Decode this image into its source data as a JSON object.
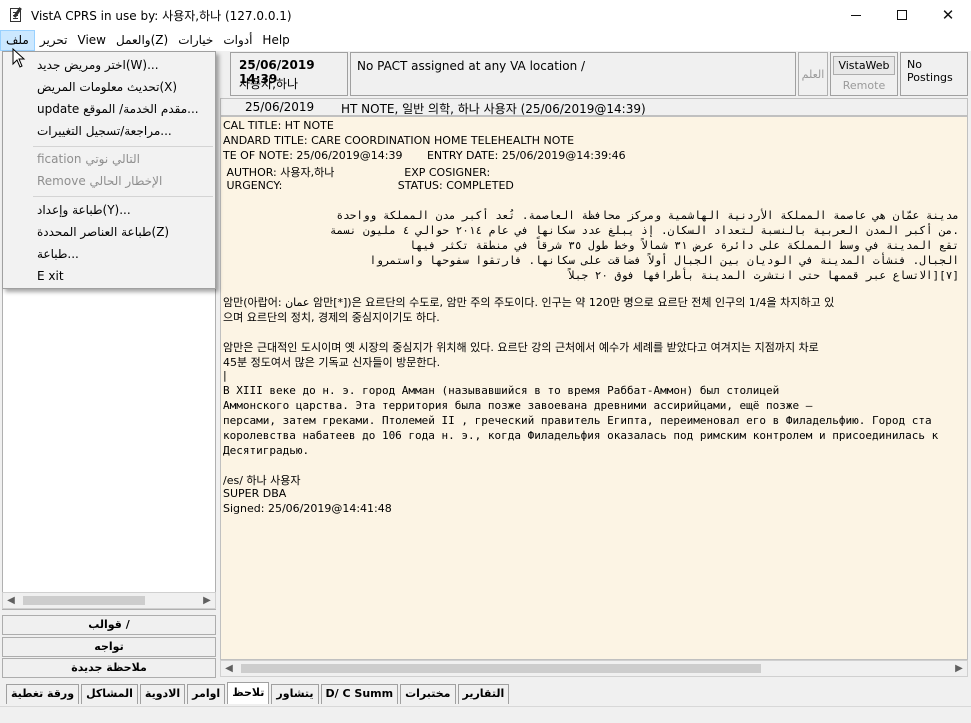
{
  "window": {
    "title": "VistA CPRS in use by: 사용자,하나  (127.0.0.1)",
    "minimize": "—",
    "maximize": "☐",
    "close": "✕"
  },
  "menubar": {
    "items": [
      "ملف",
      "تحرير",
      "View",
      "والعمل(Z)",
      "خيارات",
      "أدوات",
      "Help"
    ]
  },
  "header": {
    "date": "25/06/2019 14:39",
    "patient": "사용자,하나",
    "pact": "No PACT assigned at any VA location /",
    "flag": "العلم",
    "vistaweb": "VistaWeb",
    "remote_data": "Remote Data",
    "postings": "No Postings"
  },
  "file_menu": {
    "items": [
      {
        "label": "اختر ومريض جديد(W)...",
        "disabled": false
      },
      {
        "label": "تحديث معلومات المريض(X)",
        "disabled": false
      },
      {
        "label": "update مقدم الخدمة/ الموقع...",
        "disabled": false
      },
      {
        "label": "مراجعة/تسجيل التغييرات...",
        "disabled": false
      },
      {
        "label": "fication التالي نوتي",
        "disabled": true
      },
      {
        "label": "Remove الإخطار الحالي",
        "disabled": true
      },
      {
        "label": "طباعة وإعداد(Y)...",
        "disabled": false
      },
      {
        "label": "طباعة العناصر المحددة(Z)",
        "disabled": false
      },
      {
        "label": "طباعة...",
        "disabled": false
      },
      {
        "label": "E xit",
        "disabled": false
      }
    ]
  },
  "left_buttons": {
    "templates": "قوالب /",
    "encounter": "تواجه",
    "new_note": "ملاحظة جديدة"
  },
  "note_header": {
    "date": "25/06/2019",
    "title": "HT NOTE, 일반 의학, 하나 사용자  (25/06/2019@14:39)"
  },
  "note": {
    "local_title": "CAL TITLE: HT NOTE",
    "standard_title": "ANDARD TITLE: CARE COORDINATION HOME TELEHEALTH NOTE",
    "date_line": "TE OF NOTE: 25/06/2019@14:39       ENTRY DATE: 25/06/2019@14:39:46",
    "author_line": " AUTHOR: 사용자,하나                    EXP COSIGNER:",
    "urgency_line": " URGENCY:                                 STATUS: COMPLETED",
    "arabic": [
      "مدينة عمّان هي عاصمة المملكة الأردنية الهاشمية ومركز محافظة العاصمة. تُعد أكبر مدن المملكة وواحدة",
      ".من أكبر المدن العربية بالنسبة لتعداد السكان. إذ يبلغ عدد سكانها في عام ٢٠١٤ حوالي ٤ مليون نسمة",
      "تقع المدينة في وسط المملكة على دائرة عرض ٣١ شمالاً وخط طول ٣٥ شرقاً في منطقة تكثر فيها",
      "الجبال. فنشأت المدينة في الوديان بين الجبال أولاً فضاقت على سكانها. فارتقوا سفوحها واستمروا",
      "[٧][الاتساع عبر قممها حتى انتشرت المدينة بأطرافها فوق ٢٠ جبلاً"
    ],
    "korean1": [
      "암만(아랍어: عمان 암만[*])은 요르단의 수도로, 암만 주의 주도이다. 인구는 약 120만 명으로 요르단 전체 인구의 1/4을 차지하고 있",
      "으며 요르단의 정치, 경제의 중심지이기도 하다."
    ],
    "korean2": [
      "암만은 근대적인 도시이며 옛 시장의 중심지가 위치해 있다. 요르단 강의 근처에서 예수가 세례를 받았다고 여겨지는 지점까지 차로",
      "45분 정도여서 많은 기독교 신자들이 방문한다."
    ],
    "cursor_line": "|",
    "russian": [
      "В XIII веке до н. э. город Амман (называвшийся в то время Раббат-Аммон) был столицей",
      "Аммонского царства. Эта территория была позже завоевана древними ассирийцами, ещё позже —",
      "персами, затем греками. Птолемей II , греческий правитель Египта, переименовал его в Филадельфию. Город ста",
      "королевства набатеев до 106 года н. э., когда Филадельфия оказалась под римским контролем и присоединилась к",
      "Десятиградью."
    ],
    "sig1": "/es/ 하나 사용자",
    "sig2": "SUPER DBA",
    "sig3": "Signed: 25/06/2019@14:41:48"
  },
  "tabs": [
    {
      "label": "ورقة تغطية",
      "selected": false
    },
    {
      "label": "المشاكل",
      "selected": false
    },
    {
      "label": "الادوية",
      "selected": false
    },
    {
      "label": "اوامر",
      "selected": false
    },
    {
      "label": "تلاحظ",
      "selected": true
    },
    {
      "label": "يتشاور",
      "selected": false
    },
    {
      "label": "D/ C Summ",
      "selected": false
    },
    {
      "label": "مختبرات",
      "selected": false
    },
    {
      "label": "التقارير",
      "selected": false
    }
  ]
}
